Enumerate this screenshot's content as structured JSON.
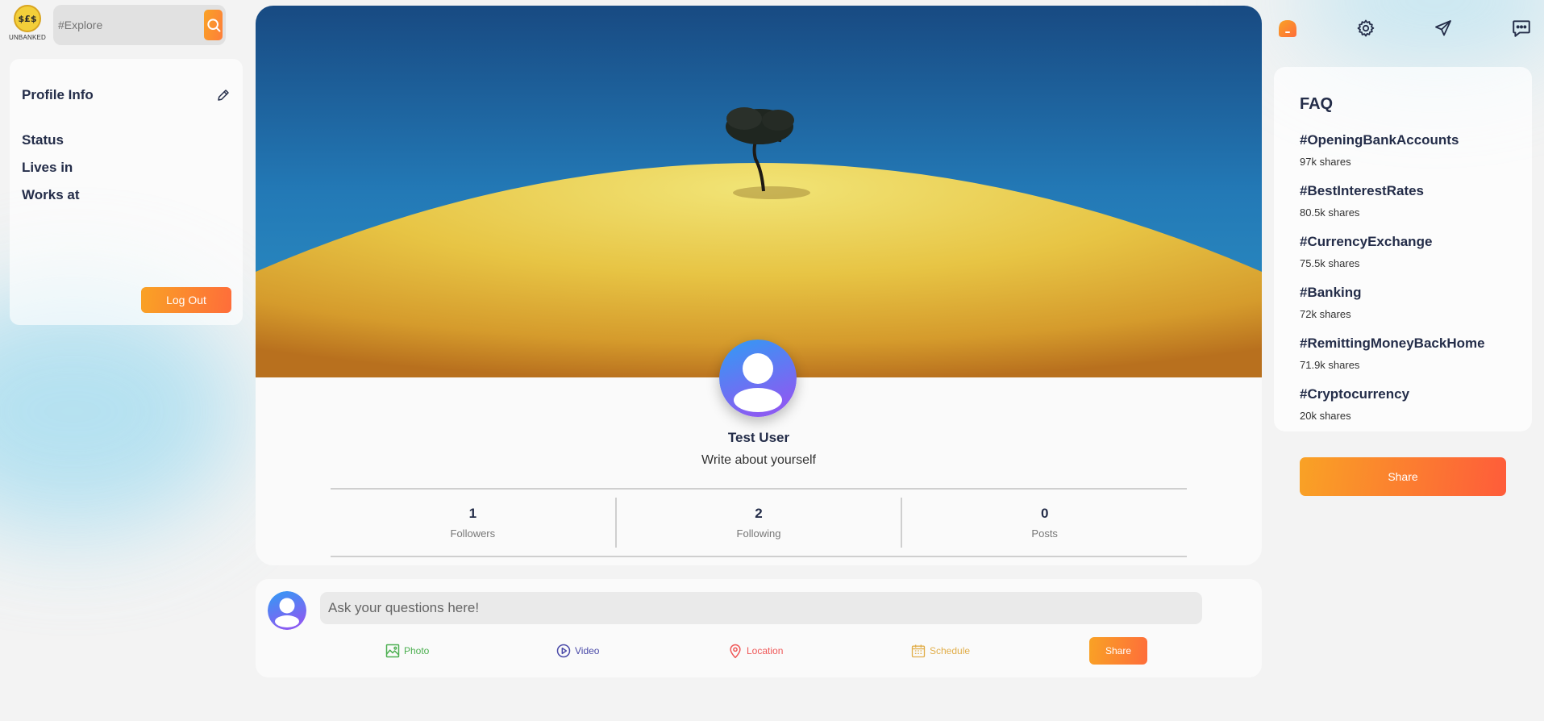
{
  "logo": {
    "text": "UNBANKED",
    "mark": "$£$"
  },
  "search": {
    "placeholder": "#Explore"
  },
  "profile_info": {
    "title": "Profile Info",
    "rows": [
      {
        "label": "Status"
      },
      {
        "label": "Lives in"
      },
      {
        "label": "Works at"
      }
    ],
    "logout_label": "Log Out"
  },
  "profile": {
    "name": "Test User",
    "bio": "Write about yourself",
    "stats": [
      {
        "value": "1",
        "label": "Followers"
      },
      {
        "value": "2",
        "label": "Following"
      },
      {
        "value": "0",
        "label": "Posts"
      }
    ]
  },
  "post_share": {
    "placeholder": "Ask your questions here!",
    "options": {
      "photo": "Photo",
      "video": "Video",
      "location": "Location",
      "schedule": "Schedule"
    },
    "share_label": "Share"
  },
  "faq": {
    "title": "FAQ",
    "trends": [
      {
        "tag": "#OpeningBankAccounts",
        "shares": "97k shares"
      },
      {
        "tag": "#BestInterestRates",
        "shares": "80.5k shares"
      },
      {
        "tag": "#CurrencyExchange",
        "shares": "75.5k shares"
      },
      {
        "tag": "#Banking",
        "shares": "72k shares"
      },
      {
        "tag": "#RemittingMoneyBackHome",
        "shares": "71.9k shares"
      },
      {
        "tag": "#Cryptocurrency",
        "shares": "20k shares"
      }
    ],
    "share_label": "Share"
  },
  "colors": {
    "accent_start": "#f9a225",
    "accent_end": "#fe6d3a",
    "text_dark": "#242d49"
  }
}
